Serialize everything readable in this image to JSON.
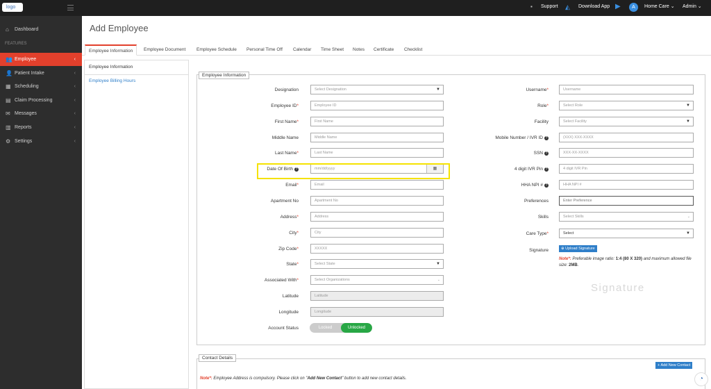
{
  "topbar": {
    "logo": "logo",
    "support": "Support",
    "download": "Download App",
    "agency": "Home Care",
    "user": "Admin"
  },
  "sidebar": {
    "items": [
      {
        "label": "Dashboard",
        "icon": "home-icon",
        "glyph": "⌂"
      },
      {
        "label": "Employee",
        "icon": "users-icon",
        "glyph": "👥"
      },
      {
        "label": "Patient Intake",
        "icon": "user-icon",
        "glyph": "👤"
      },
      {
        "label": "Scheduling",
        "icon": "calendar-icon",
        "glyph": "▦"
      },
      {
        "label": "Claim Processing",
        "icon": "claim-icon",
        "glyph": "▤"
      },
      {
        "label": "Messages",
        "icon": "envelope-icon",
        "glyph": "✉"
      },
      {
        "label": "Reports",
        "icon": "chart-icon",
        "glyph": "▥"
      },
      {
        "label": "Settings",
        "icon": "gear-icon",
        "glyph": "⚙"
      }
    ],
    "section_label": "FEATURES"
  },
  "page_title": "Add Employee",
  "tabs": [
    "Employee Information",
    "Employee Document",
    "Employee Schedule",
    "Personal Time Off",
    "Calendar",
    "Time Sheet",
    "Notes",
    "Certificate",
    "Checklist"
  ],
  "subnav": [
    "Employee Information",
    "Employee Billing Hours"
  ],
  "section_title": "Employee Information",
  "form_left": [
    {
      "label": "Designation",
      "req": false,
      "help": false,
      "placeholder": "Select Designation",
      "type": "select"
    },
    {
      "label": "Employee ID",
      "req": true,
      "help": false,
      "placeholder": "Employee ID",
      "type": "text"
    },
    {
      "label": "First Name",
      "req": true,
      "help": false,
      "placeholder": "First Name",
      "type": "text"
    },
    {
      "label": "Middle Name",
      "req": false,
      "help": false,
      "placeholder": "Middle Name",
      "type": "text"
    },
    {
      "label": "Last Name",
      "req": true,
      "help": false,
      "placeholder": "Last Name",
      "type": "text"
    },
    {
      "label": "Date Of Birth",
      "req": false,
      "help": true,
      "placeholder": "mm/dd/yyyy",
      "type": "date"
    },
    {
      "label": "Email",
      "req": true,
      "help": false,
      "placeholder": "Email",
      "type": "text"
    },
    {
      "label": "Apartment No",
      "req": false,
      "help": false,
      "placeholder": "Apartment No",
      "type": "text"
    },
    {
      "label": "Address",
      "req": true,
      "help": false,
      "placeholder": "Address",
      "type": "text"
    },
    {
      "label": "City",
      "req": true,
      "help": false,
      "placeholder": "City",
      "type": "text"
    },
    {
      "label": "Zip Code",
      "req": true,
      "help": false,
      "placeholder": "XXXXX",
      "type": "text"
    },
    {
      "label": "State",
      "req": true,
      "help": false,
      "placeholder": "Select State",
      "type": "select"
    },
    {
      "label": "Associated With",
      "req": true,
      "help": false,
      "placeholder": "Select Organizations",
      "type": "multiselect"
    },
    {
      "label": "Latitude",
      "req": false,
      "help": false,
      "placeholder": "Latitude",
      "type": "disabled"
    },
    {
      "label": "Longitude",
      "req": false,
      "help": false,
      "placeholder": "Longitude",
      "type": "disabled"
    }
  ],
  "form_right": [
    {
      "label": "Username",
      "req": true,
      "help": false,
      "placeholder": "Username",
      "type": "text"
    },
    {
      "label": "Role",
      "req": true,
      "help": false,
      "placeholder": "Select Role",
      "type": "select"
    },
    {
      "label": "Facility",
      "req": false,
      "help": false,
      "placeholder": "Select Facility",
      "type": "select"
    },
    {
      "label": "Mobile Number / IVR ID",
      "req": false,
      "help": true,
      "placeholder": "(XXX) XXX-XXXX",
      "type": "text"
    },
    {
      "label": "SSN",
      "req": false,
      "help": true,
      "placeholder": "XXX-XX-XXXX",
      "type": "text"
    },
    {
      "label": "4 digit IVR Pin",
      "req": false,
      "help": true,
      "placeholder": "4 digit IVR Pin",
      "type": "text"
    },
    {
      "label": "HHA NPI #",
      "req": false,
      "help": true,
      "placeholder": "HHA NPI #",
      "type": "text"
    },
    {
      "label": "Preferences",
      "req": false,
      "help": false,
      "placeholder": "Enter Preference",
      "type": "text"
    },
    {
      "label": "Skills",
      "req": false,
      "help": false,
      "placeholder": "Select Skills",
      "type": "multiselect"
    },
    {
      "label": "Care Type",
      "req": true,
      "help": false,
      "placeholder": "Select",
      "type": "select"
    }
  ],
  "account_status": {
    "label": "Account Status",
    "off": "Locked",
    "on": "Unlocked"
  },
  "signature": {
    "label": "Signature",
    "button": "Upload Signature",
    "note_prefix": "Note*:",
    "note_text": " Preferable image ratio: ",
    "ratio": "1:4 (80 X 320)",
    "note_mid": " and maximum allowed file size: ",
    "size": "2MB",
    "note_end": ".",
    "watermark": "Signature"
  },
  "contact": {
    "title": "Contact Details",
    "add_button": "Add New Contact",
    "note_prefix": "Note*:",
    "note_text": " Employee Address is compulsory. Please click on \"",
    "note_link": "Add New Contact",
    "note_end": "\" button to add new contact details."
  },
  "colors": {
    "accent": "#e2402c",
    "sidebar": "#2d2d2d",
    "topbar": "#1f1f1f",
    "toggle_on": "#28a745",
    "highlight": "#f5e200"
  }
}
